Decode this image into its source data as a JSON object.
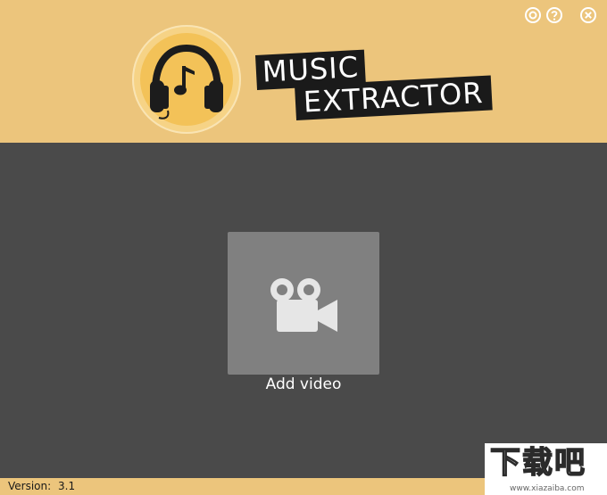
{
  "app": {
    "title_line1": "MUSIC",
    "title_line2": "EXTRACTOR",
    "logo_icon": "headphones-music-note-icon",
    "accent_color": "#ecc57c"
  },
  "titlebar": {
    "settings_icon": "settings-ring-icon",
    "help_icon": "help-question-icon",
    "close_icon": "close-x-icon"
  },
  "main": {
    "add_video_icon": "video-camera-icon",
    "add_video_label": "Add video"
  },
  "footer": {
    "version_label": "Version:",
    "version_value": "3.1"
  },
  "watermark": {
    "text": "下载吧",
    "url": "www.xiazaiba.com"
  }
}
